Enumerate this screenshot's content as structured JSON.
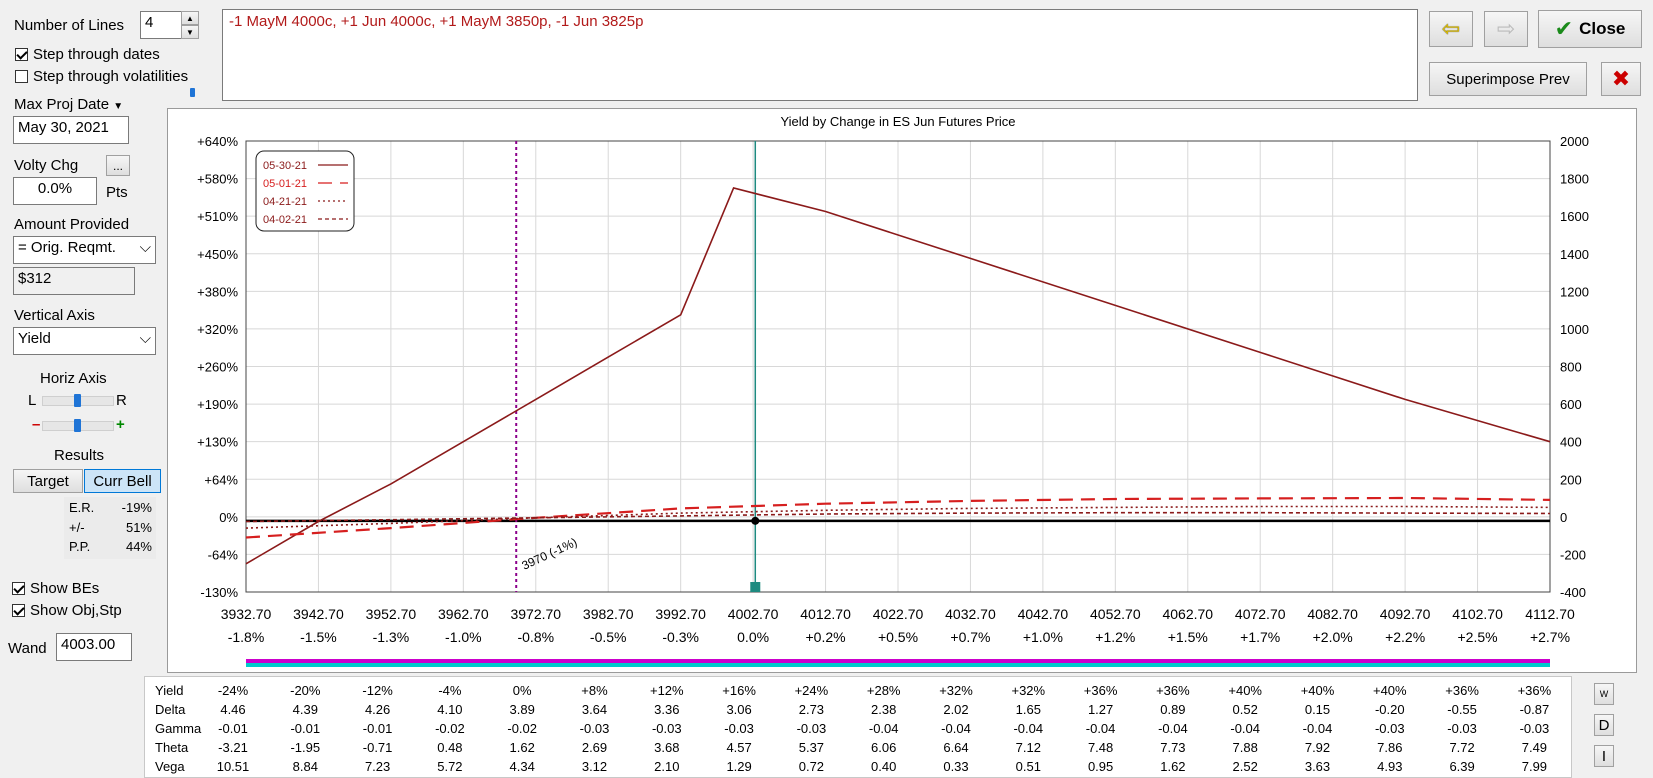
{
  "controls": {
    "num_lines_label": "Number of Lines",
    "num_lines_value": "4",
    "step_dates_label": "Step through dates",
    "step_dates_checked": true,
    "step_vols_label": "Step through volatilities",
    "step_vols_checked": false,
    "max_proj_date_label": "Max Proj Date",
    "max_proj_date_value": "May 30, 2021",
    "volty_chg_label": "Volty Chg",
    "volty_chg_button": "...",
    "volty_chg_value": "0.0%",
    "volty_chg_unit": "Pts",
    "amount_provided_label": "Amount Provided",
    "amount_provided_value": "= Orig. Reqmt.",
    "amount_value": "$312",
    "vertical_axis_label": "Vertical Axis",
    "vertical_axis_value": "Yield",
    "horiz_axis_label": "Horiz Axis",
    "horiz_left": "L",
    "horiz_right": "R",
    "zoom_minus": "–",
    "zoom_plus": "+",
    "results_label": "Results",
    "target_button": "Target",
    "curr_bell_button": "Curr Bell",
    "results": [
      {
        "label": "E.R.",
        "value": "-19%"
      },
      {
        "label": "+/-",
        "value": "51%"
      },
      {
        "label": "P.P.",
        "value": "44%"
      }
    ],
    "show_bes_label": "Show BEs",
    "show_bes_checked": true,
    "show_obj_label": "Show Obj,Stp",
    "show_obj_checked": true,
    "wand_label": "Wand",
    "wand_value": "4003.00"
  },
  "position_text": "-1 MayM 4000c, +1 Jun 4000c, +1 MayM 3850p, -1 Jun 3825p",
  "buttons": {
    "close": "Close",
    "superimpose": "Superimpose Prev"
  },
  "table": {
    "rows": [
      {
        "label": "Yield",
        "values": [
          "-24%",
          "-20%",
          "-12%",
          "-4%",
          "0%",
          "+8%",
          "+12%",
          "+16%",
          "+24%",
          "+28%",
          "+32%",
          "+32%",
          "+36%",
          "+36%",
          "+40%",
          "+40%",
          "+40%",
          "+36%",
          "+36%"
        ]
      },
      {
        "label": "Delta",
        "values": [
          "4.46",
          "4.39",
          "4.26",
          "4.10",
          "3.89",
          "3.64",
          "3.36",
          "3.06",
          "2.73",
          "2.38",
          "2.02",
          "1.65",
          "1.27",
          "0.89",
          "0.52",
          "0.15",
          "-0.20",
          "-0.55",
          "-0.87"
        ]
      },
      {
        "label": "Gamma",
        "values": [
          "-0.01",
          "-0.01",
          "-0.01",
          "-0.02",
          "-0.02",
          "-0.03",
          "-0.03",
          "-0.03",
          "-0.03",
          "-0.04",
          "-0.04",
          "-0.04",
          "-0.04",
          "-0.04",
          "-0.04",
          "-0.04",
          "-0.03",
          "-0.03",
          "-0.03"
        ]
      },
      {
        "label": "Theta",
        "values": [
          "-3.21",
          "-1.95",
          "-0.71",
          "0.48",
          "1.62",
          "2.69",
          "3.68",
          "4.57",
          "5.37",
          "6.06",
          "6.64",
          "7.12",
          "7.48",
          "7.73",
          "7.88",
          "7.92",
          "7.86",
          "7.72",
          "7.49"
        ]
      },
      {
        "label": "Vega",
        "values": [
          "10.51",
          "8.84",
          "7.23",
          "5.72",
          "4.34",
          "3.12",
          "2.10",
          "1.29",
          "0.72",
          "0.40",
          "0.33",
          "0.51",
          "0.95",
          "1.62",
          "2.52",
          "3.63",
          "4.93",
          "6.39",
          "7.99"
        ]
      }
    ],
    "side_buttons": [
      "W",
      "D",
      "I"
    ]
  },
  "chart_data": {
    "type": "line",
    "title": "Yield by Change in ES Jun Futures Price",
    "x_ticks": [
      "3932.70",
      "3942.70",
      "3952.70",
      "3962.70",
      "3972.70",
      "3982.70",
      "3992.70",
      "4002.70",
      "4012.70",
      "4022.70",
      "4032.70",
      "4042.70",
      "4052.70",
      "4062.70",
      "4072.70",
      "4082.70",
      "4092.70",
      "4102.70",
      "4112.70"
    ],
    "x_pct_ticks": [
      "-1.8%",
      "-1.5%",
      "-1.3%",
      "-1.0%",
      "-0.8%",
      "-0.5%",
      "-0.3%",
      "0.0%",
      "+0.2%",
      "+0.5%",
      "+0.7%",
      "+1.0%",
      "+1.2%",
      "+1.5%",
      "+1.7%",
      "+2.0%",
      "+2.2%",
      "+2.5%",
      "+2.7%"
    ],
    "xlim": [
      3932.7,
      4112.7
    ],
    "y_left_ticks": [
      "+640%",
      "+580%",
      "+510%",
      "+450%",
      "+380%",
      "+320%",
      "+260%",
      "+190%",
      "+130%",
      "+64%",
      "0%",
      "-64%",
      "-130%"
    ],
    "y_right_ticks": [
      "2000",
      "1800",
      "1600",
      "1400",
      "1200",
      "1000",
      "800",
      "600",
      "400",
      "200",
      "0",
      "-200",
      "-400"
    ],
    "ylim": [
      -400,
      2000
    ],
    "legend_position": "top-left",
    "series": [
      {
        "name": "05-30-21",
        "style": "solid",
        "color": "#8b1a1a",
        "x": [
          3932.7,
          3942.7,
          3952.7,
          3962.7,
          3972.7,
          3982.7,
          3992.7,
          4000.0,
          4012.7,
          4032.7,
          4052.7,
          4072.7,
          4092.7,
          4112.7
        ],
        "y": [
          -250,
          -25,
          175,
          400,
          625,
          850,
          1075,
          1750,
          1625,
          1375,
          1125,
          875,
          625,
          400
        ]
      },
      {
        "name": "05-01-21",
        "style": "longdash",
        "color": "#d61f1f",
        "x": [
          3932.7,
          3952.7,
          3972.7,
          3992.7,
          4012.7,
          4032.7,
          4052.7,
          4072.7,
          4092.7,
          4112.7
        ],
        "y": [
          -110,
          -60,
          -5,
          45,
          70,
          85,
          95,
          98,
          100,
          90
        ]
      },
      {
        "name": "04-21-21",
        "style": "dotted",
        "color": "#8b1a1a",
        "x": [
          3932.7,
          3952.7,
          3972.7,
          3992.7,
          4012.7,
          4032.7,
          4052.7,
          4072.7,
          4092.7,
          4112.7
        ],
        "y": [
          -60,
          -35,
          -5,
          20,
          35,
          45,
          50,
          55,
          55,
          50
        ]
      },
      {
        "name": "04-02-21",
        "style": "dashed-fine",
        "color": "#8b1a1a",
        "x": [
          3932.7,
          3952.7,
          3972.7,
          3992.7,
          4012.7,
          4032.7,
          4052.7,
          4072.7,
          4092.7,
          4112.7
        ],
        "y": [
          -25,
          -15,
          -5,
          5,
          15,
          20,
          22,
          22,
          20,
          18
        ]
      }
    ],
    "breakeven": {
      "x": 3970.0,
      "label": "3970 (-1%)"
    },
    "wand_x": 4003.0,
    "zero_line_y": 0,
    "colors": {
      "breakeven": "#8b008b",
      "wand": "#1e8a80",
      "bar_magenta": "#cc00cc",
      "bar_cyan": "#00cccc"
    }
  }
}
